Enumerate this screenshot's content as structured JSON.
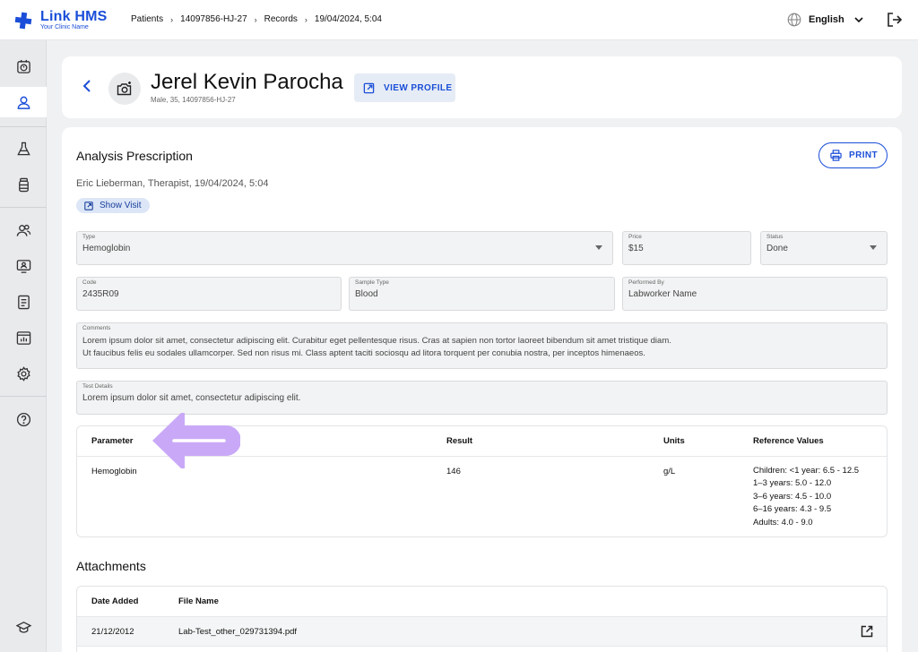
{
  "app": {
    "name": "Link HMS",
    "subtitle": "Your Clinic Name",
    "accent": "#1a4ed8"
  },
  "breadcrumb": [
    "Patients",
    "14097856-HJ-27",
    "Records",
    "19/04/2024, 5:04"
  ],
  "language": "English",
  "sidebar_icons": [
    "timer-icon",
    "user-icon",
    "flask-icon",
    "medicine-bottle-icon",
    "users-icon",
    "monitor-user-icon",
    "clipboard-list-icon",
    "chart-report-icon",
    "settings-icon",
    "help-icon",
    "graduation-cap-icon"
  ],
  "patient": {
    "name": "Jerel Kevin Parocha",
    "meta": "Male, 35, 14097856-HJ-27",
    "view_profile": "VIEW PROFILE"
  },
  "prescription": {
    "title": "Analysis Prescription",
    "doctor_line": "Eric Lieberman, Therapist, 19/04/2024, 5:04",
    "show_visit": "Show Visit",
    "print": "PRINT",
    "fields": {
      "type": {
        "label": "Type",
        "value": "Hemoglobin"
      },
      "price": {
        "label": "Price",
        "value": "$15"
      },
      "status": {
        "label": "Status",
        "value": "Done"
      },
      "code": {
        "label": "Code",
        "value": "2435R09"
      },
      "sample_type": {
        "label": "Sample Type",
        "value": "Blood"
      },
      "performed_by": {
        "label": "Performed By",
        "value": "Labworker Name"
      },
      "comments": {
        "label": "Comments",
        "line1": "Lorem ipsum dolor sit amet, consectetur adipiscing elit. Curabitur eget pellentesque risus. Cras at sapien non tortor laoreet bibendum sit amet tristique diam.",
        "line2": "Ut faucibus felis eu sodales ullamcorper. Sed non risus mi. Class aptent taciti sociosqu ad litora torquent per conubia nostra, per inceptos himenaeos."
      },
      "test_details": {
        "label": "Test Details",
        "value": "Lorem ipsum dolor sit amet, consectetur adipiscing elit."
      }
    },
    "results_table": {
      "headers": {
        "parameter": "Parameter",
        "result": "Result",
        "units": "Units",
        "reference": "Reference Values"
      },
      "row": {
        "parameter": "Hemoglobin",
        "result": "146",
        "units": "g/L",
        "reference": [
          "Children: <1 year: 6.5 - 12.5",
          "1–3 years: 5.0 - 12.0",
          "3–6 years: 4.5 - 10.0",
          "6–16 years: 4.3 - 9.5",
          "Adults: 4.0 - 9.0"
        ]
      }
    }
  },
  "annotation_arrow_color": "#c9a9f7",
  "attachments": {
    "title": "Attachments",
    "headers": {
      "date": "Date Added",
      "file": "File Name"
    },
    "rows": [
      {
        "date": "21/12/2012",
        "file": "Lab-Test_other_029731394.pdf"
      }
    ]
  }
}
